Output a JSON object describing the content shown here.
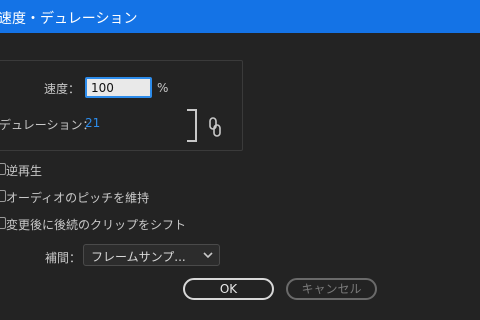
{
  "window": {
    "title": "速度・デュレーション"
  },
  "speed": {
    "label": "速度：",
    "value": "100",
    "unit": "%"
  },
  "duration": {
    "label": "デュレーション：",
    "value": "21"
  },
  "link": {
    "icon": "chain-link-icon"
  },
  "options": {
    "reverse": {
      "label": "逆再生",
      "checked": false
    },
    "maintain_pitch": {
      "label": "オーディオのピッチを維持",
      "checked": false
    },
    "ripple": {
      "label": "変更後に後続のクリップをシフト",
      "checked": false
    }
  },
  "interpolation": {
    "label": "補間：",
    "selected": "フレームサンプ..."
  },
  "buttons": {
    "ok": "OK",
    "cancel": "キャンセル"
  },
  "colors": {
    "titlebar": "#1473e6",
    "accent": "#2d8ceb",
    "background": "#232323"
  }
}
